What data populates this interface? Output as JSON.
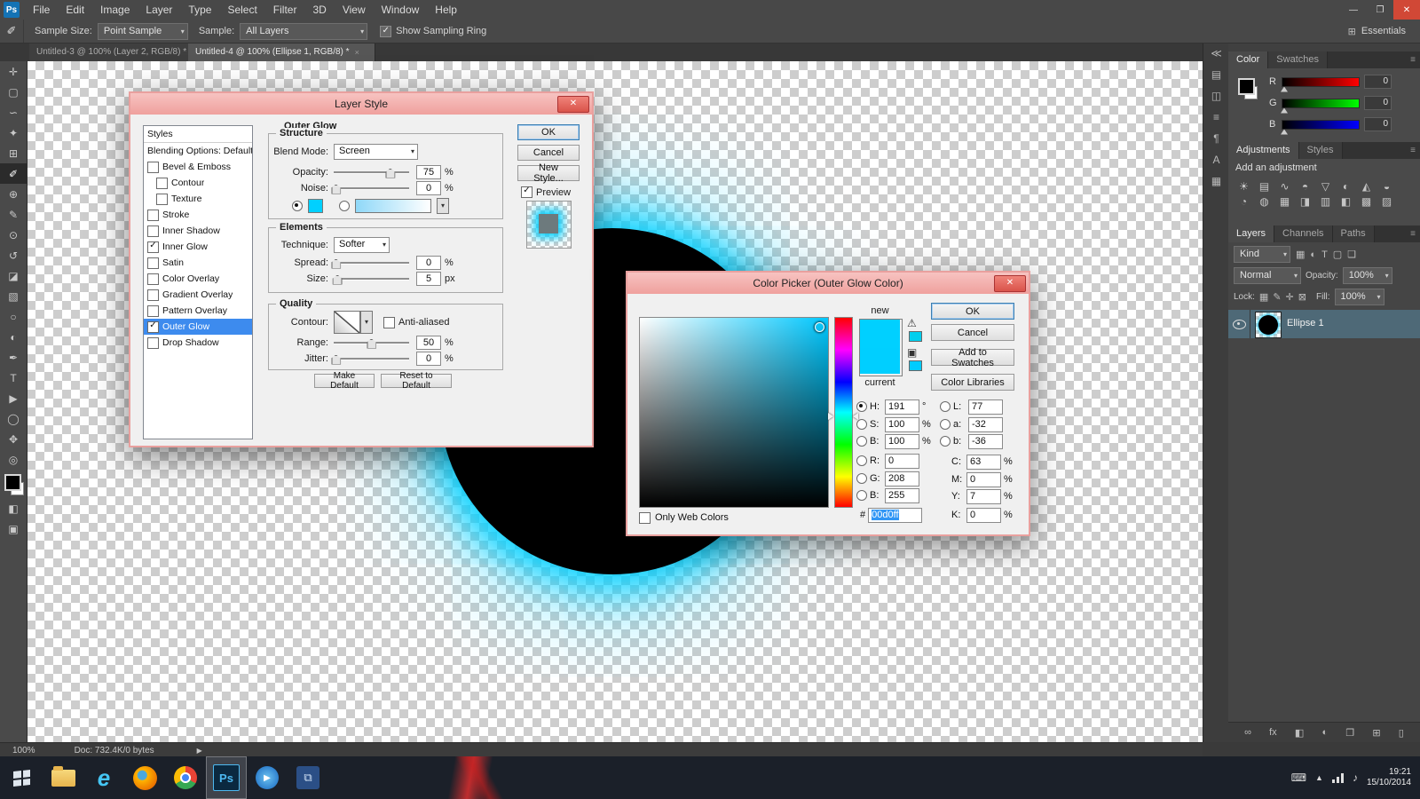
{
  "colors": {
    "glow_cyan": "#00d0ff",
    "selection_blue": "#3d8bee",
    "dialog_chrome_red": "#efa09d"
  },
  "app": {
    "logo": "Ps",
    "menus": [
      "File",
      "Edit",
      "Image",
      "Layer",
      "Type",
      "Select",
      "Filter",
      "3D",
      "View",
      "Window",
      "Help"
    ],
    "window_controls": {
      "minimize": "—",
      "maximize": "❐",
      "close": "✕"
    },
    "workspace": "Essentials",
    "workspace_icon": "⊞"
  },
  "options_bar": {
    "tool_icon": "✐",
    "sample_size_label": "Sample Size:",
    "sample_size_value": "Point Sample",
    "sample_label": "Sample:",
    "sample_value": "All Layers",
    "show_sampling_ring": "Show Sampling Ring"
  },
  "document_tabs": [
    {
      "title": "Untitled-3 @ 100% (Layer 2, RGB/8) *",
      "close": "×"
    },
    {
      "title": "Untitled-4 @ 100% (Ellipse 1, RGB/8) *",
      "close": "×"
    }
  ],
  "tools": [
    {
      "name": "move",
      "glyph": "✛"
    },
    {
      "name": "marquee",
      "glyph": "▢"
    },
    {
      "name": "lasso",
      "glyph": "∽"
    },
    {
      "name": "quick-selection",
      "glyph": "✦"
    },
    {
      "name": "crop",
      "glyph": "⊞"
    },
    {
      "name": "eyedropper",
      "glyph": "✐"
    },
    {
      "name": "healing-brush",
      "glyph": "⊕"
    },
    {
      "name": "brush",
      "glyph": "✎"
    },
    {
      "name": "clone-stamp",
      "glyph": "⊙"
    },
    {
      "name": "history-brush",
      "glyph": "↺"
    },
    {
      "name": "eraser",
      "glyph": "◪"
    },
    {
      "name": "gradient",
      "glyph": "▧"
    },
    {
      "name": "blur",
      "glyph": "○"
    },
    {
      "name": "dodge",
      "glyph": "◐"
    },
    {
      "name": "pen",
      "glyph": "✒"
    },
    {
      "name": "type",
      "glyph": "T"
    },
    {
      "name": "path-selection",
      "glyph": "▶"
    },
    {
      "name": "shape",
      "glyph": "◯"
    },
    {
      "name": "hand",
      "glyph": "✥"
    },
    {
      "name": "zoom",
      "glyph": "◎"
    }
  ],
  "toolbar_extra": {
    "quick_mask": "◧",
    "screen_mode": "▣"
  },
  "dock_strip": {
    "collapse": "≪",
    "icons": [
      {
        "name": "history-panel",
        "glyph": "▤"
      },
      {
        "name": "properties-panel",
        "glyph": "◫"
      },
      {
        "name": "info-panel",
        "glyph": "≡"
      },
      {
        "name": "paragraph-panel",
        "glyph": "¶"
      },
      {
        "name": "character-panel",
        "glyph": "A"
      },
      {
        "name": "clone-source-panel",
        "glyph": "▦"
      }
    ]
  },
  "panels": {
    "color": {
      "tabs": [
        "Color",
        "Swatches"
      ],
      "menu_icon": "≡",
      "sliders": [
        {
          "label": "R",
          "value": "0"
        },
        {
          "label": "G",
          "value": "0"
        },
        {
          "label": "B",
          "value": "0"
        }
      ]
    },
    "adjustments": {
      "tabs": [
        "Adjustments",
        "Styles"
      ],
      "heading": "Add an adjustment",
      "icons": [
        {
          "name": "brightness-contrast",
          "glyph": "☀"
        },
        {
          "name": "levels",
          "glyph": "▤"
        },
        {
          "name": "curves",
          "glyph": "∿"
        },
        {
          "name": "exposure",
          "glyph": "◓"
        },
        {
          "name": "vibrance",
          "glyph": "▽"
        },
        {
          "name": "hue-saturation",
          "glyph": "◐"
        },
        {
          "name": "color-balance",
          "glyph": "◭"
        },
        {
          "name": "black-white",
          "glyph": "◒"
        },
        {
          "name": "photo-filter",
          "glyph": "◔"
        },
        {
          "name": "channel-mixer",
          "glyph": "◍"
        },
        {
          "name": "color-lookup",
          "glyph": "▦"
        },
        {
          "name": "invert",
          "glyph": "◨"
        },
        {
          "name": "posterize",
          "glyph": "▥"
        },
        {
          "name": "threshold",
          "glyph": "◧"
        },
        {
          "name": "gradient-map",
          "glyph": "▩"
        },
        {
          "name": "selective-color",
          "glyph": "▨"
        }
      ]
    },
    "layers": {
      "tabs": [
        "Layers",
        "Channels",
        "Paths"
      ],
      "kind_value": "Kind",
      "filter_icons": [
        {
          "name": "filter-pixel-layers",
          "glyph": "▦"
        },
        {
          "name": "filter-adjustment-layers",
          "glyph": "◐"
        },
        {
          "name": "filter-type-layers",
          "glyph": "T"
        },
        {
          "name": "filter-shape-layers",
          "glyph": "▢"
        },
        {
          "name": "filter-smart-objects",
          "glyph": "❏"
        }
      ],
      "blend_value": "Normal",
      "opacity_label": "Opacity:",
      "opacity_value": "100%",
      "lock_label": "Lock:",
      "lock_icons": [
        {
          "name": "lock-transparent-pixels",
          "glyph": "▦"
        },
        {
          "name": "lock-image-pixels",
          "glyph": "✎"
        },
        {
          "name": "lock-position",
          "glyph": "✛"
        },
        {
          "name": "lock-all",
          "glyph": "⊠"
        }
      ],
      "fill_label": "Fill:",
      "fill_value": "100%",
      "layer_name": "Ellipse 1",
      "bottom_icons": [
        {
          "name": "link-layers",
          "glyph": "∞"
        },
        {
          "name": "layer-effects",
          "glyph": "fx"
        },
        {
          "name": "add-layer-mask",
          "glyph": "◧"
        },
        {
          "name": "new-adjustment-layer",
          "glyph": "◐"
        },
        {
          "name": "new-group",
          "glyph": "❐"
        },
        {
          "name": "new-layer",
          "glyph": "⊞"
        },
        {
          "name": "delete-layer",
          "glyph": "▯"
        }
      ]
    }
  },
  "layer_style": {
    "title": "Layer Style",
    "styles_list": [
      "Styles",
      "Blending Options: Default",
      "Bevel & Emboss",
      "Contour",
      "Texture",
      "Stroke",
      "Inner Shadow",
      "Inner Glow",
      "Satin",
      "Color Overlay",
      "Gradient Overlay",
      "Pattern Overlay",
      "Outer Glow",
      "Drop Shadow"
    ],
    "section_title": "Outer Glow",
    "structure": {
      "label": "Structure",
      "blend_mode_label": "Blend Mode:",
      "blend_mode_value": "Screen",
      "opacity_label": "Opacity:",
      "opacity_value": "75",
      "opacity_unit": "%",
      "noise_label": "Noise:",
      "noise_value": "0",
      "noise_unit": "%"
    },
    "elements": {
      "label": "Elements",
      "technique_label": "Technique:",
      "technique_value": "Softer",
      "spread_label": "Spread:",
      "spread_value": "0",
      "spread_unit": "%",
      "size_label": "Size:",
      "size_value": "5",
      "size_unit": "px"
    },
    "quality": {
      "label": "Quality",
      "contour_label": "Contour:",
      "anti_aliased_label": "Anti-aliased",
      "range_label": "Range:",
      "range_value": "50",
      "range_unit": "%",
      "jitter_label": "Jitter:",
      "jitter_value": "0",
      "jitter_unit": "%"
    },
    "buttons": {
      "ok": "OK",
      "cancel": "Cancel",
      "new_style": "New Style...",
      "preview": "Preview",
      "make_default": "Make Default",
      "reset_default": "Reset to Default"
    },
    "glow_color": "#00d0ff"
  },
  "color_picker": {
    "title": "Color Picker (Outer Glow Color)",
    "new_label": "new",
    "current_label": "current",
    "gamut_warning_icon": "⚠",
    "web_cube_icon": "▣",
    "buttons": {
      "ok": "OK",
      "cancel": "Cancel",
      "add_to_swatches": "Add to Swatches",
      "color_libraries": "Color Libraries"
    },
    "hsb": {
      "h_label": "H:",
      "h_value": "191",
      "h_unit": "°",
      "s_label": "S:",
      "s_value": "100",
      "s_unit": "%",
      "b_label": "B:",
      "b_value": "100",
      "b_unit": "%"
    },
    "rgb": {
      "r_label": "R:",
      "r_value": "0",
      "g_label": "G:",
      "g_value": "208",
      "b_label": "B:",
      "b_value": "255"
    },
    "lab": {
      "l_label": "L:",
      "l_value": "77",
      "a_label": "a:",
      "a_value": "-32",
      "b_label": "b:",
      "b_value": "-36"
    },
    "cmyk": {
      "c_label": "C:",
      "c_value": "63",
      "c_unit": "%",
      "m_label": "M:",
      "m_value": "0",
      "m_unit": "%",
      "y_label": "Y:",
      "y_value": "7",
      "y_unit": "%",
      "k_label": "K:",
      "k_value": "0",
      "k_unit": "%"
    },
    "hex_label": "#",
    "hex_value": "00d0ff",
    "only_web_colors": "Only Web Colors",
    "new_color": "#00d0ff",
    "current_color": "#00cfff"
  },
  "status_bar": {
    "zoom": "100%",
    "doc_info": "Doc: 732.4K/0 bytes",
    "arrow": "▶"
  },
  "taskbar": {
    "time": "19:21",
    "date": "15/10/2014",
    "apps": [
      {
        "name": "file-explorer",
        "glyph": ""
      },
      {
        "name": "internet-explorer",
        "glyph": "e"
      },
      {
        "name": "firefox",
        "glyph": ""
      },
      {
        "name": "chrome",
        "glyph": ""
      },
      {
        "name": "photoshop",
        "glyph": "Ps"
      },
      {
        "name": "media-player",
        "glyph": "▶"
      },
      {
        "name": "movie-maker",
        "glyph": "⧉"
      }
    ],
    "tray": [
      {
        "name": "touch-keyboard",
        "glyph": "⌨"
      },
      {
        "name": "show-hidden-icons",
        "glyph": "▲"
      },
      {
        "name": "volume",
        "glyph": "♪"
      }
    ]
  }
}
